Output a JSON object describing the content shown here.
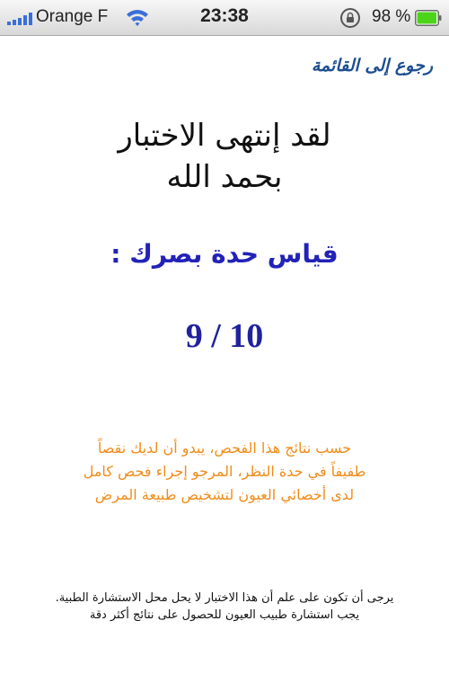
{
  "status_bar": {
    "carrier": "Orange F",
    "time": "23:38",
    "battery_percent": "98 %",
    "battery_level": 0.98,
    "signal_bars": 5
  },
  "nav": {
    "back_label": "رجوع إلى القائمة"
  },
  "result": {
    "headline_line1": "لقد إنتهى الاختبار",
    "headline_line2": "بحمد الله",
    "score_label": "قياس حدة بصرك :",
    "score_value": "9 / 10"
  },
  "advice": {
    "line1": "حسب نتائج هذا الفحص، يبدو أن لديك نقصاً",
    "line2": "طفيفاً في حدة النظر، المرجو إجراء فحص كامل",
    "line3": "لدى أخصائي العيون لتشخيص طبيعة المرض"
  },
  "disclaimer": {
    "line1": "يرجى أن تكون على علم أن هذا الاختبار لا يحل محل الاستشارة الطبية.",
    "line2": "يجب استشارة طبيب العيون للحصول على نتائج أكثر دقة"
  },
  "colors": {
    "back_link": "#1e4f8f",
    "score": "#2222b8",
    "advice": "#f08c1a",
    "battery": "#4cd418"
  },
  "icons": {
    "signal": "signal-bars-icon",
    "wifi": "wifi-icon",
    "rotation_lock": "rotation-lock-icon",
    "battery": "battery-icon"
  }
}
